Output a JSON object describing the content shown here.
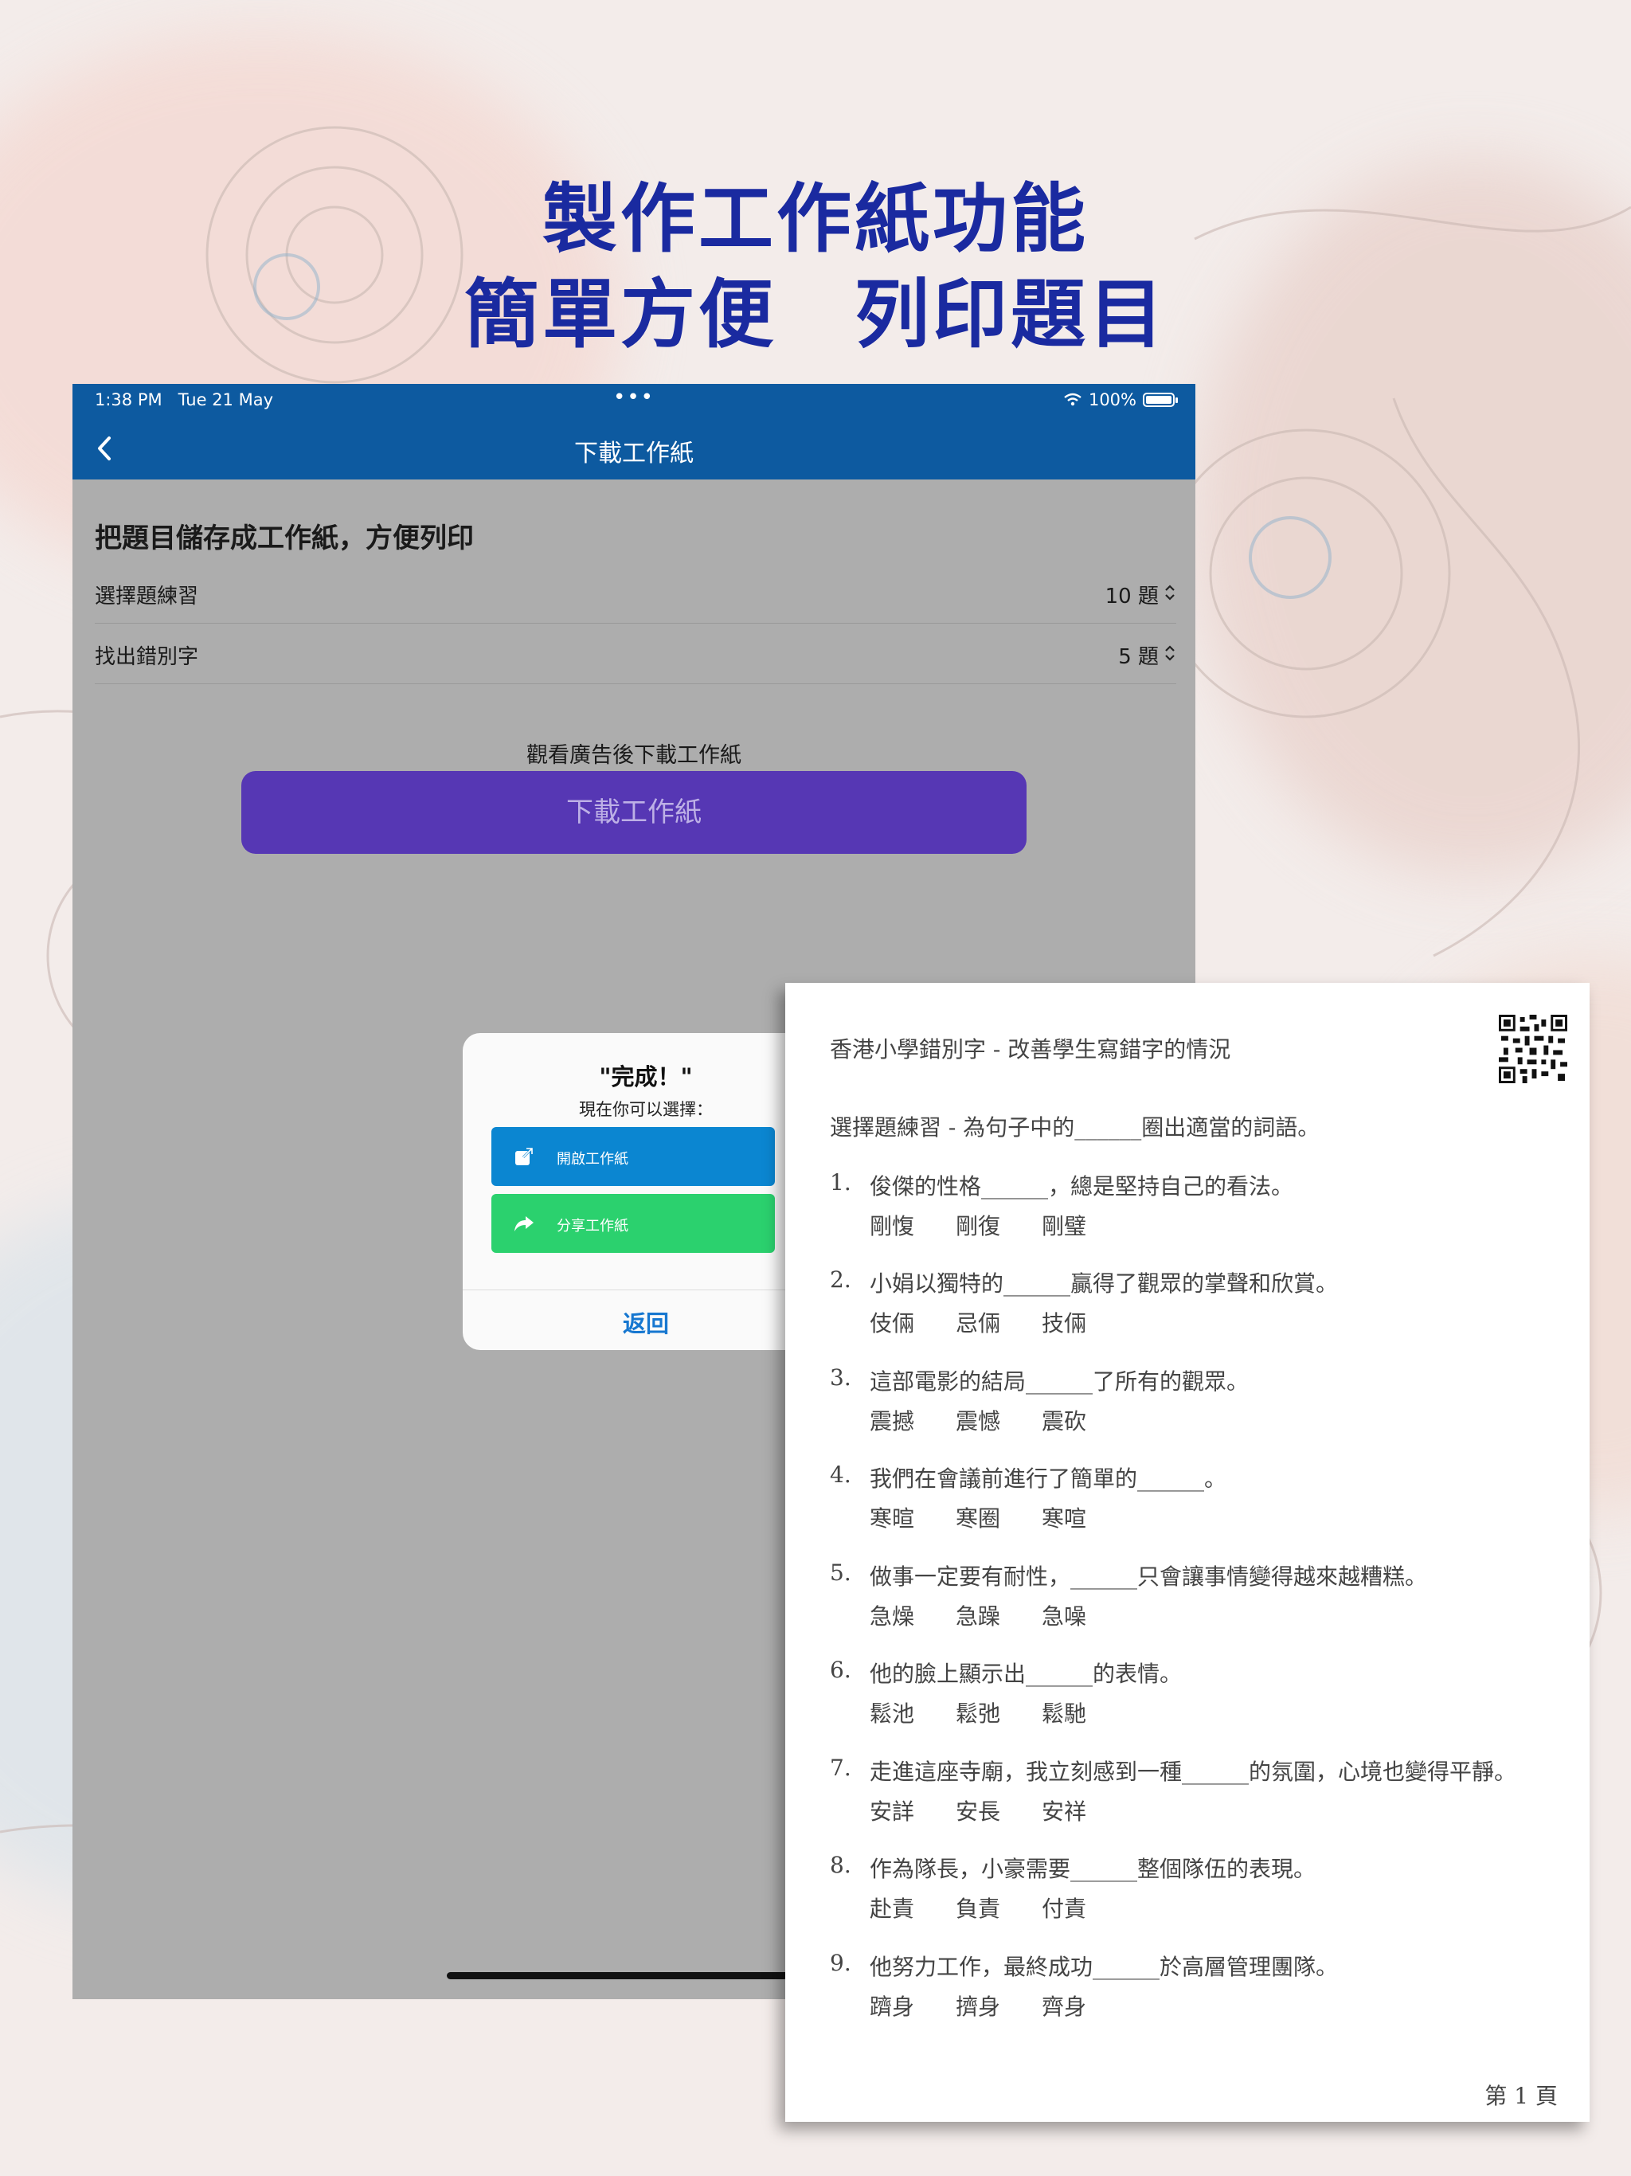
{
  "headline": {
    "line1": "製作工作紙功能",
    "line2": "簡單方便　列印題目"
  },
  "status_bar": {
    "time": "1:38 PM",
    "date": "Tue 21 May",
    "dots": "•••",
    "battery": "100%"
  },
  "nav": {
    "title": "下載工作紙"
  },
  "content": {
    "section_title": "把題目儲存成工作紙，方便列印",
    "rows": [
      {
        "label": "選擇題練習",
        "value": "10 題"
      },
      {
        "label": "找出錯別字",
        "value": "5 題"
      }
    ],
    "ad_caption": "觀看廣告後下載工作紙",
    "download_button": "下載工作紙"
  },
  "alert": {
    "title": "\"完成！\"",
    "subtitle": "現在你可以選擇：",
    "open_button": "開啟工作紙",
    "share_button": "分享工作紙",
    "back_button": "返回"
  },
  "worksheet": {
    "header": "香港小學錯別字 - 改善學生寫錯字的情況",
    "intro": "選擇題練習 - 為句子中的______圈出適當的詞語。",
    "questions": [
      {
        "num": "1.",
        "text": "俊傑的性格______，總是堅持自己的看法。",
        "options": [
          "剛愎",
          "剛復",
          "剛璧"
        ]
      },
      {
        "num": "2.",
        "text": "小娟以獨特的______贏得了觀眾的掌聲和欣賞。",
        "options": [
          "伎倆",
          "忌倆",
          "技倆"
        ]
      },
      {
        "num": "3.",
        "text": "這部電影的結局______了所有的觀眾。",
        "options": [
          "震撼",
          "震憾",
          "震砍"
        ]
      },
      {
        "num": "4.",
        "text": "我們在會議前進行了簡單的______。",
        "options": [
          "寒暄",
          "寒圈",
          "寒喧"
        ]
      },
      {
        "num": "5.",
        "text": "做事一定要有耐性，______只會讓事情變得越來越糟糕。",
        "options": [
          "急燥",
          "急躁",
          "急噪"
        ]
      },
      {
        "num": "6.",
        "text": "他的臉上顯示出______的表情。",
        "options": [
          "鬆池",
          "鬆弛",
          "鬆馳"
        ]
      },
      {
        "num": "7.",
        "text": "走進這座寺廟，我立刻感到一種______的氛圍，心境也變得平靜。",
        "options": [
          "安詳",
          "安長",
          "安祥"
        ]
      },
      {
        "num": "8.",
        "text": "作為隊長，小豪需要______整個隊伍的表現。",
        "options": [
          "赴責",
          "負責",
          "付責"
        ]
      },
      {
        "num": "9.",
        "text": "他努力工作，最終成功______於高層管理團隊。",
        "options": [
          "躋身",
          "擠身",
          "齊身"
        ]
      }
    ],
    "page_label": "第 1 頁"
  },
  "colors": {
    "headline": "#1a2aa0",
    "nav_bar": "#0d5aa0",
    "download_button": "#5637b4",
    "open_button": "#0b86d1",
    "share_button": "#2bd16e",
    "back_link": "#1677d0"
  }
}
